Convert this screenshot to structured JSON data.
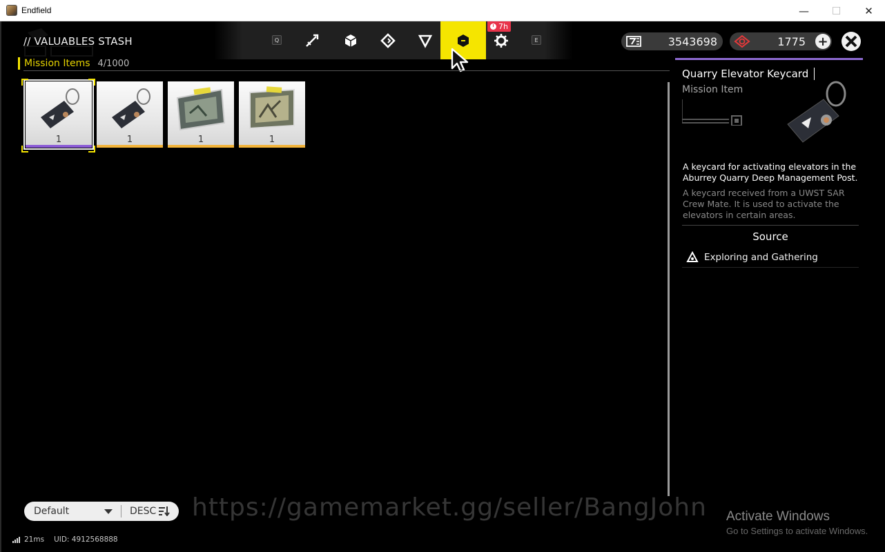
{
  "window": {
    "title": "Endfield",
    "minimize": "—",
    "maximize": "☐",
    "close": "✕"
  },
  "header": {
    "title": "// VALUABLES STASH",
    "key_prev": "Q",
    "key_next": "E",
    "timer_badge": "7h",
    "tabs": [
      {
        "icon": "weapon-tab-icon",
        "active": false
      },
      {
        "icon": "cube-tab-icon",
        "active": false
      },
      {
        "icon": "material-tab-icon",
        "active": false
      },
      {
        "icon": "triangle-tab-icon",
        "active": false
      },
      {
        "icon": "mission-items-tab-icon",
        "active": true
      },
      {
        "icon": "gear-tab-icon",
        "active": false
      }
    ]
  },
  "currencies": {
    "primary_value": "3543698",
    "secondary_value": "1775",
    "add_label": "+"
  },
  "category": {
    "label": "Mission Items",
    "count": "4/1000"
  },
  "items": [
    {
      "type": "keycard",
      "qty": "1",
      "rarity": "purple",
      "selected": true
    },
    {
      "type": "keycard",
      "qty": "1",
      "rarity": "gold",
      "selected": false
    },
    {
      "type": "photo",
      "qty": "1",
      "rarity": "gold",
      "selected": false
    },
    {
      "type": "photo",
      "qty": "1",
      "rarity": "gold",
      "selected": false
    }
  ],
  "detail": {
    "name": "Quarry Elevator Keycard",
    "type": "Mission Item",
    "description": "A keycard for activating elevators in the Aburrey Quarry Deep Management Post.",
    "lore": "A keycard received from a UWST SAR Crew Mate. It is used to activate the elevators in certain areas.",
    "source_title": "Source",
    "source_entry": "Exploring and Gathering"
  },
  "sort": {
    "mode": "Default",
    "order": "DESC"
  },
  "status": {
    "ping": "21ms",
    "uid": "UID: 4912568888"
  },
  "overlay": {
    "watermark": "https://gamemarket.gg/seller/BangJohn",
    "activate_title": "Activate Windows",
    "activate_sub": "Go to Settings to activate Windows."
  },
  "colors": {
    "accent_yellow": "#f5e500",
    "rarity_purple": "#8b5bd6",
    "rarity_gold": "#f3b43a",
    "badge_red": "#e8334a"
  }
}
